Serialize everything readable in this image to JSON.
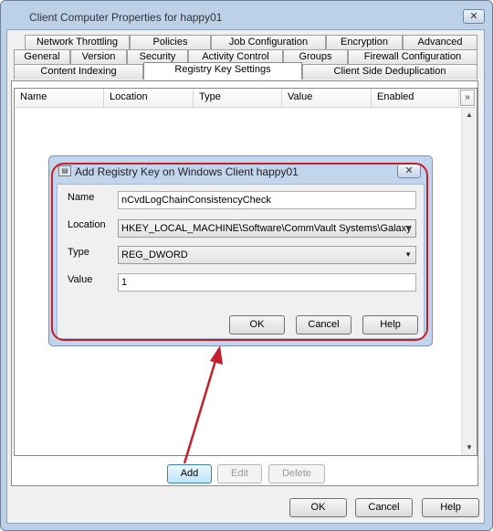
{
  "window": {
    "title": "Client Computer Properties for happy01",
    "close_glyph": "✕"
  },
  "tabs": {
    "row1": [
      "Network Throttling",
      "Policies",
      "Job Configuration",
      "Encryption",
      "Advanced"
    ],
    "row2": [
      "General",
      "Version",
      "Security",
      "Activity Control",
      "Groups",
      "Firewall Configuration"
    ],
    "row3": [
      "Content Indexing",
      "Registry Key Settings",
      "Client Side Deduplication"
    ],
    "active": "Registry Key Settings"
  },
  "list": {
    "columns": [
      "Name",
      "Location",
      "Type",
      "Value",
      "Enabled"
    ],
    "column_chooser_glyph": "»",
    "rows": []
  },
  "list_buttons": {
    "add": "Add",
    "edit": "Edit",
    "delete": "Delete"
  },
  "dialog": {
    "title": "Add Registry Key on Windows Client  happy01",
    "close_glyph": "✕",
    "fields": {
      "name_label": "Name",
      "name_value": "nCvdLogChainConsistencyCheck",
      "location_label": "Location",
      "location_value": "HKEY_LOCAL_MACHINE\\Software\\CommVault Systems\\Galaxy",
      "type_label": "Type",
      "type_value": "REG_DWORD",
      "value_label": "Value",
      "value_value": "1"
    },
    "buttons": {
      "ok": "OK",
      "cancel": "Cancel",
      "help": "Help"
    }
  },
  "footer_buttons": {
    "ok": "OK",
    "cancel": "Cancel",
    "help": "Help"
  },
  "colors": {
    "annotation": "#c2202a",
    "window_frame": "#bcd1e8"
  },
  "icons": {
    "dialog_icon": "registry-key-icon",
    "dropdown": "chevron-down-icon",
    "scroll_up": "scroll-up-icon",
    "scroll_down": "scroll-down-icon"
  }
}
